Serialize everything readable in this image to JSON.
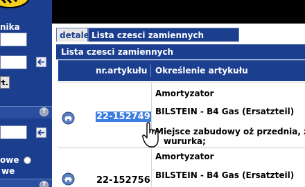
{
  "sidebar": {
    "label_1": "nika",
    "button_label": "rt.",
    "radio_1_label": "owe",
    "radio_2_label": "we",
    "help_icon": "question-icon",
    "arrow_icon": "arrow-left-icon"
  },
  "tabs": {
    "detale": "detale",
    "lista": "Lista czesci zamiennych"
  },
  "panel": {
    "title": "Lista czesci zamiennych",
    "col_nr": "nr.artykułu",
    "col_okreslenie": "Określenie artykułu"
  },
  "rows": [
    {
      "name": "Amortyzator",
      "brand": "BILSTEIN - B4 Gas (Ersatzteil)",
      "detail_line1": "Miejsce zabudowy oż przednia, z",
      "detail_line2": "wururka;",
      "nr": "22-152749",
      "selected": true
    },
    {
      "name": "Amortyzator",
      "brand": "BILSTEIN - B4 Gas (Ersatzteil)",
      "nr": "22-152756",
      "selected": false
    }
  ],
  "colors": {
    "accent_blue": "#1b3e8f",
    "selection": "#3b7de0",
    "topbar": "#000000"
  }
}
